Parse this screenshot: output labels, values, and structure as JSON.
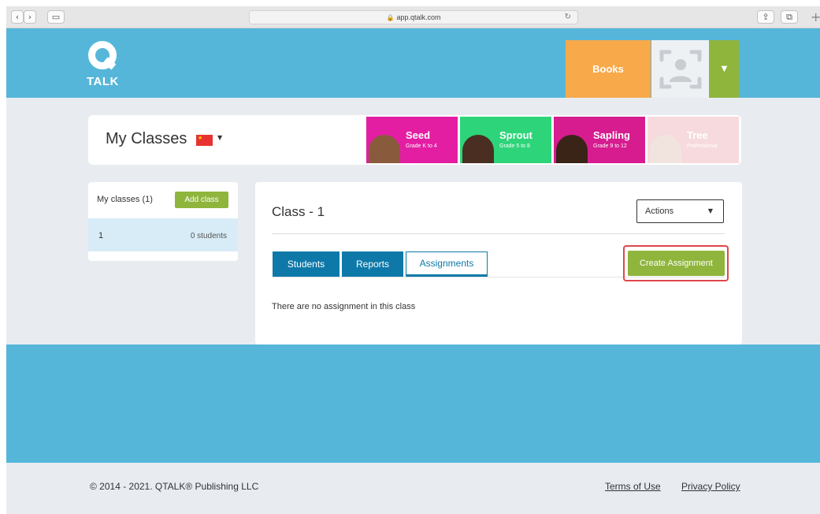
{
  "browser": {
    "url": "app.qtalk.com"
  },
  "header": {
    "logo_text": "TALK",
    "books_label": "Books"
  },
  "classes_bar": {
    "title": "My Classes",
    "levels": [
      {
        "name": "Seed",
        "grade": "Grade K to 4",
        "color": "#e31ea3"
      },
      {
        "name": "Sprout",
        "grade": "Grade 5 to 8",
        "color": "#2ed47a"
      },
      {
        "name": "Sapling",
        "grade": "Grade 9 to 12",
        "color": "#d61c8f"
      },
      {
        "name": "Tree",
        "grade": "Professional",
        "color": "#f7dadd"
      }
    ]
  },
  "sidebar": {
    "count_label": "My classes (1)",
    "add_class_label": "Add class",
    "classes": [
      {
        "name": "1",
        "students": "0 students"
      }
    ]
  },
  "main": {
    "class_title": "Class - 1",
    "actions_label": "Actions",
    "tabs": [
      {
        "label": "Students"
      },
      {
        "label": "Reports"
      },
      {
        "label": "Assignments"
      }
    ],
    "create_label": "Create Assignment",
    "empty_message": "There are no assignment in this class"
  },
  "footer": {
    "copyright": "© 2014 - 2021. QTALK® Publishing LLC",
    "terms": "Terms of Use",
    "privacy": "Privacy Policy"
  },
  "colors": {
    "brand_blue": "#56b6da",
    "tab_blue": "#0e79a8",
    "green": "#8fb53c",
    "orange": "#f8a94a",
    "highlight": "#e0474c"
  }
}
